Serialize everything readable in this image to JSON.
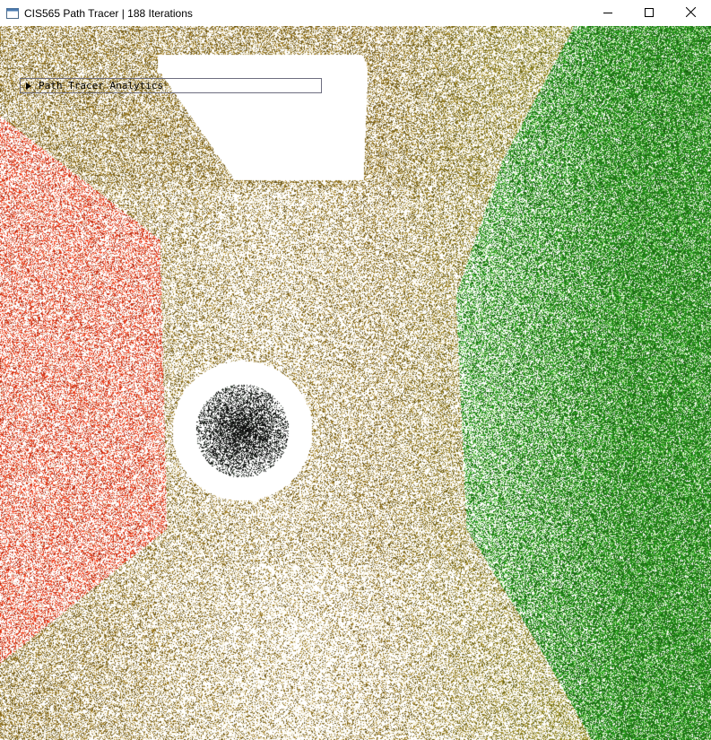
{
  "window": {
    "title": "CIS565 Path Tracer | 188 Iterations",
    "icon": "app-window-icon",
    "controls": [
      "minimize-icon",
      "maximize-icon",
      "close-icon"
    ]
  },
  "panel": {
    "label": "Path Tracer Analytics",
    "icon": "collapse-arrow-icon",
    "expanded": false
  },
  "scene": {
    "left_wall_color": "#c8401e",
    "right_wall_color": "#2a8a1e",
    "light_color": "#ffffff",
    "floor_tint": "#8a6a2a",
    "sphere_color": "#111111"
  }
}
